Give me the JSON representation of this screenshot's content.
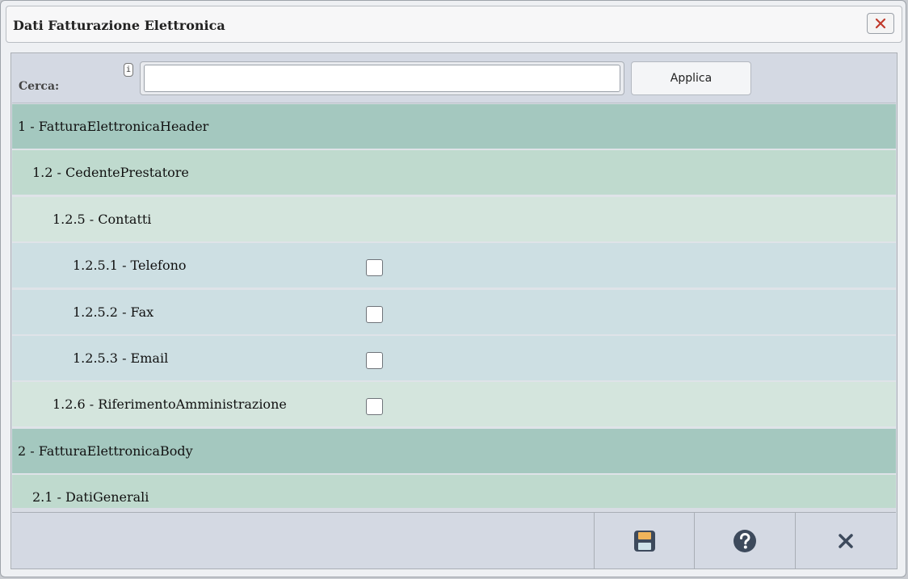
{
  "dialog": {
    "title": "Dati Fatturazione Elettronica",
    "close_icon": "close-icon"
  },
  "search": {
    "label": "Cerca:",
    "info_icon_text": "i",
    "value": "",
    "placeholder": "",
    "apply_label": "Applica"
  },
  "tree": {
    "rows": [
      {
        "label": "1 - FatturaElettronicaHeader",
        "level": 1,
        "checkbox": false
      },
      {
        "label": "1.2 - CedentePrestatore",
        "level": 2,
        "checkbox": false
      },
      {
        "label": "1.2.5 - Contatti",
        "level": 3,
        "checkbox": false
      },
      {
        "label": "1.2.5.1 - Telefono",
        "level": 4,
        "checkbox": true,
        "checked": false
      },
      {
        "label": "1.2.5.2 - Fax",
        "level": 4,
        "checkbox": true,
        "checked": false
      },
      {
        "label": "1.2.5.3 - Email",
        "level": 4,
        "checkbox": true,
        "checked": false
      },
      {
        "label": "1.2.6 - RiferimentoAmministrazione",
        "level": 3,
        "checkbox": true,
        "checked": false
      },
      {
        "label": "2 - FatturaElettronicaBody",
        "level": 1,
        "checkbox": false
      },
      {
        "label": "2.1 - DatiGenerali",
        "level": 2,
        "checkbox": false
      }
    ]
  },
  "footer": {
    "buttons": [
      {
        "name": "save-button",
        "icon": "save-icon",
        "color": "#3d4a5c"
      },
      {
        "name": "help-button",
        "icon": "help-icon",
        "color": "#3d4a5c"
      },
      {
        "name": "close-button",
        "icon": "close-icon",
        "color": "#3d4a5c"
      }
    ]
  },
  "colors": {
    "accent_close": "#c0392b",
    "level1": "#a4c8bf",
    "level2": "#bfdace",
    "level3": "#d4e5dd",
    "level4": "#cddfe3"
  }
}
